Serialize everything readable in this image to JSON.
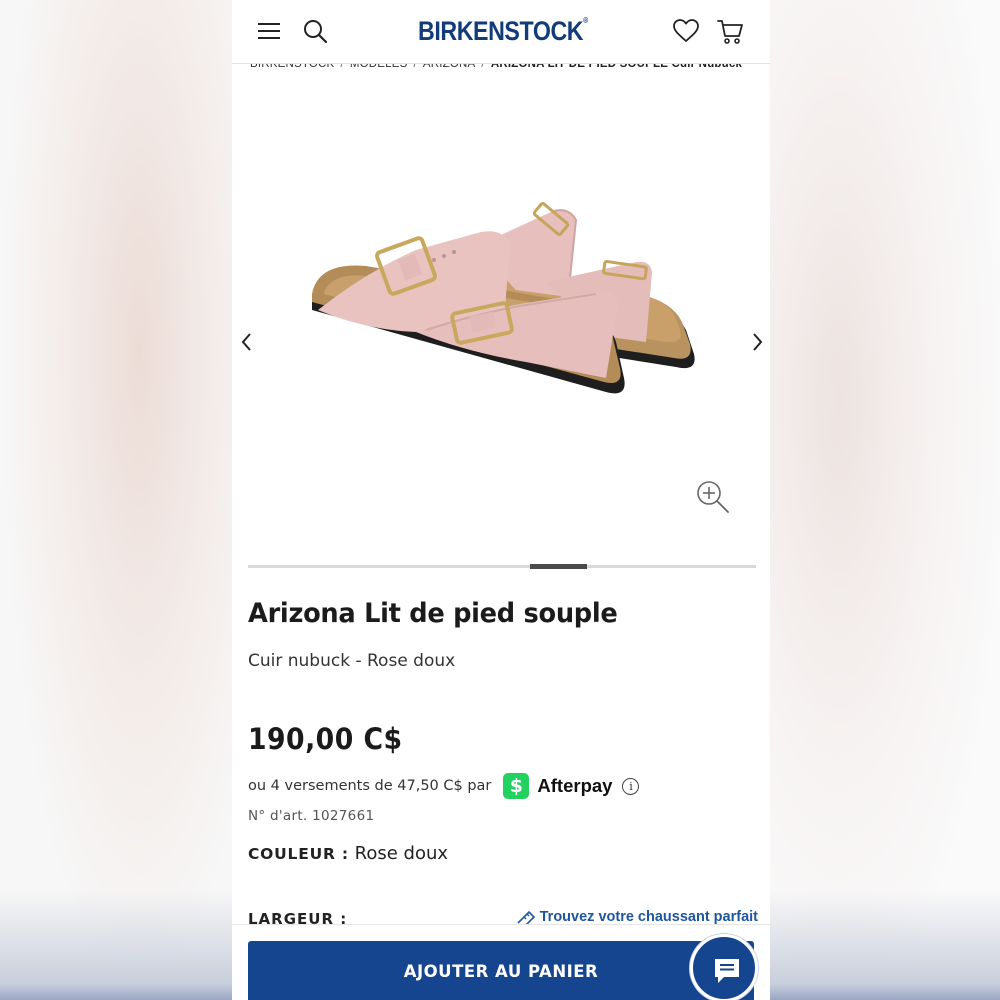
{
  "header": {
    "logo": "BIRKENSTOCK",
    "logo_mark": "®",
    "icons": [
      "hamburger-menu-icon",
      "search-icon",
      "heart-icon",
      "cart-icon"
    ]
  },
  "breadcrumb": {
    "items": [
      "BIRKENSTOCK",
      "MODÈLES",
      "ARIZONA"
    ],
    "separator": "/",
    "current": "ARIZONA LIT DE PIED SOUPLE Cuir Nubuck"
  },
  "gallery": {
    "image": "pink-nubuck-two-strap-sandal",
    "prev_icon": "chevron-left-icon",
    "next_icon": "chevron-right-icon",
    "zoom_icon": "zoom-in-icon"
  },
  "product": {
    "title": "Arizona Lit de pied souple",
    "subtitle": "Cuir nubuck - Rose doux",
    "price": "190,00 C$",
    "installments_text": "ou 4 versements de 47,50 C$ par",
    "afterpay_badge": "$",
    "afterpay_name": "Afterpay",
    "info_glyph": "i",
    "article_number": "N° d'art. 1027661",
    "color_label": "COULEUR :",
    "color_value": "Rose doux",
    "width_label": "LARGEUR :",
    "fit_link": "Trouvez votre chaussant parfait"
  },
  "actions": {
    "add_to_cart": "AJOUTER AU PANIER",
    "chat_icon": "chat-bubble-icon"
  },
  "colors": {
    "brand_blue": "#15458f",
    "logo_blue": "#123b7a",
    "afterpay_green": "#23d160",
    "sandal_pink": "#e8c3c0"
  }
}
